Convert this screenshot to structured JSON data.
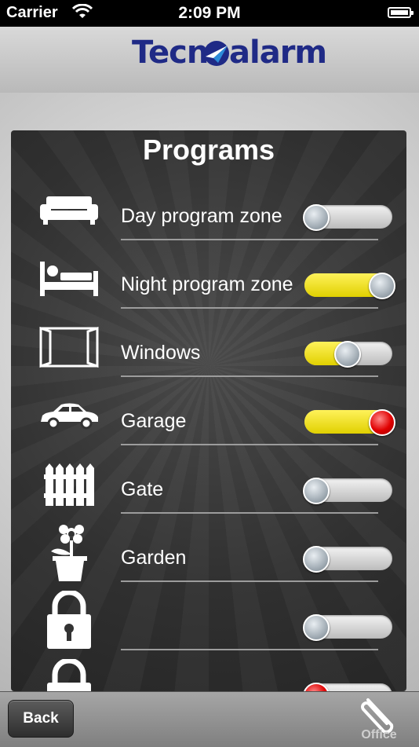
{
  "status_bar": {
    "carrier": "Carrier",
    "time": "2:09 PM"
  },
  "header": {
    "logo_left": "Tecn",
    "logo_right": "alarm"
  },
  "panel": {
    "title": "Programs"
  },
  "programs": [
    {
      "label": "Day program zone",
      "icon": "sofa-icon",
      "state": "off",
      "knob": "gray"
    },
    {
      "label": "Night program zone",
      "icon": "bed-icon",
      "state": "on",
      "knob": "gray"
    },
    {
      "label": "Windows",
      "icon": "window-icon",
      "state": "partial",
      "knob": "gray"
    },
    {
      "label": "Garage",
      "icon": "car-icon",
      "state": "on",
      "knob": "red"
    },
    {
      "label": "Gate",
      "icon": "gate-icon",
      "state": "off",
      "knob": "gray"
    },
    {
      "label": "Garden",
      "icon": "flower-icon",
      "state": "off",
      "knob": "gray"
    },
    {
      "label": "",
      "icon": "lock-icon",
      "state": "off",
      "knob": "gray"
    },
    {
      "label": "",
      "icon": "lock-icon",
      "state": "off",
      "knob": "red"
    }
  ],
  "bottom_bar": {
    "back_label": "Back",
    "office_label": "Office"
  },
  "colors": {
    "accent_yellow": "#f2e200",
    "logo_blue": "#1f2a86",
    "panel_bg": "#333333"
  }
}
